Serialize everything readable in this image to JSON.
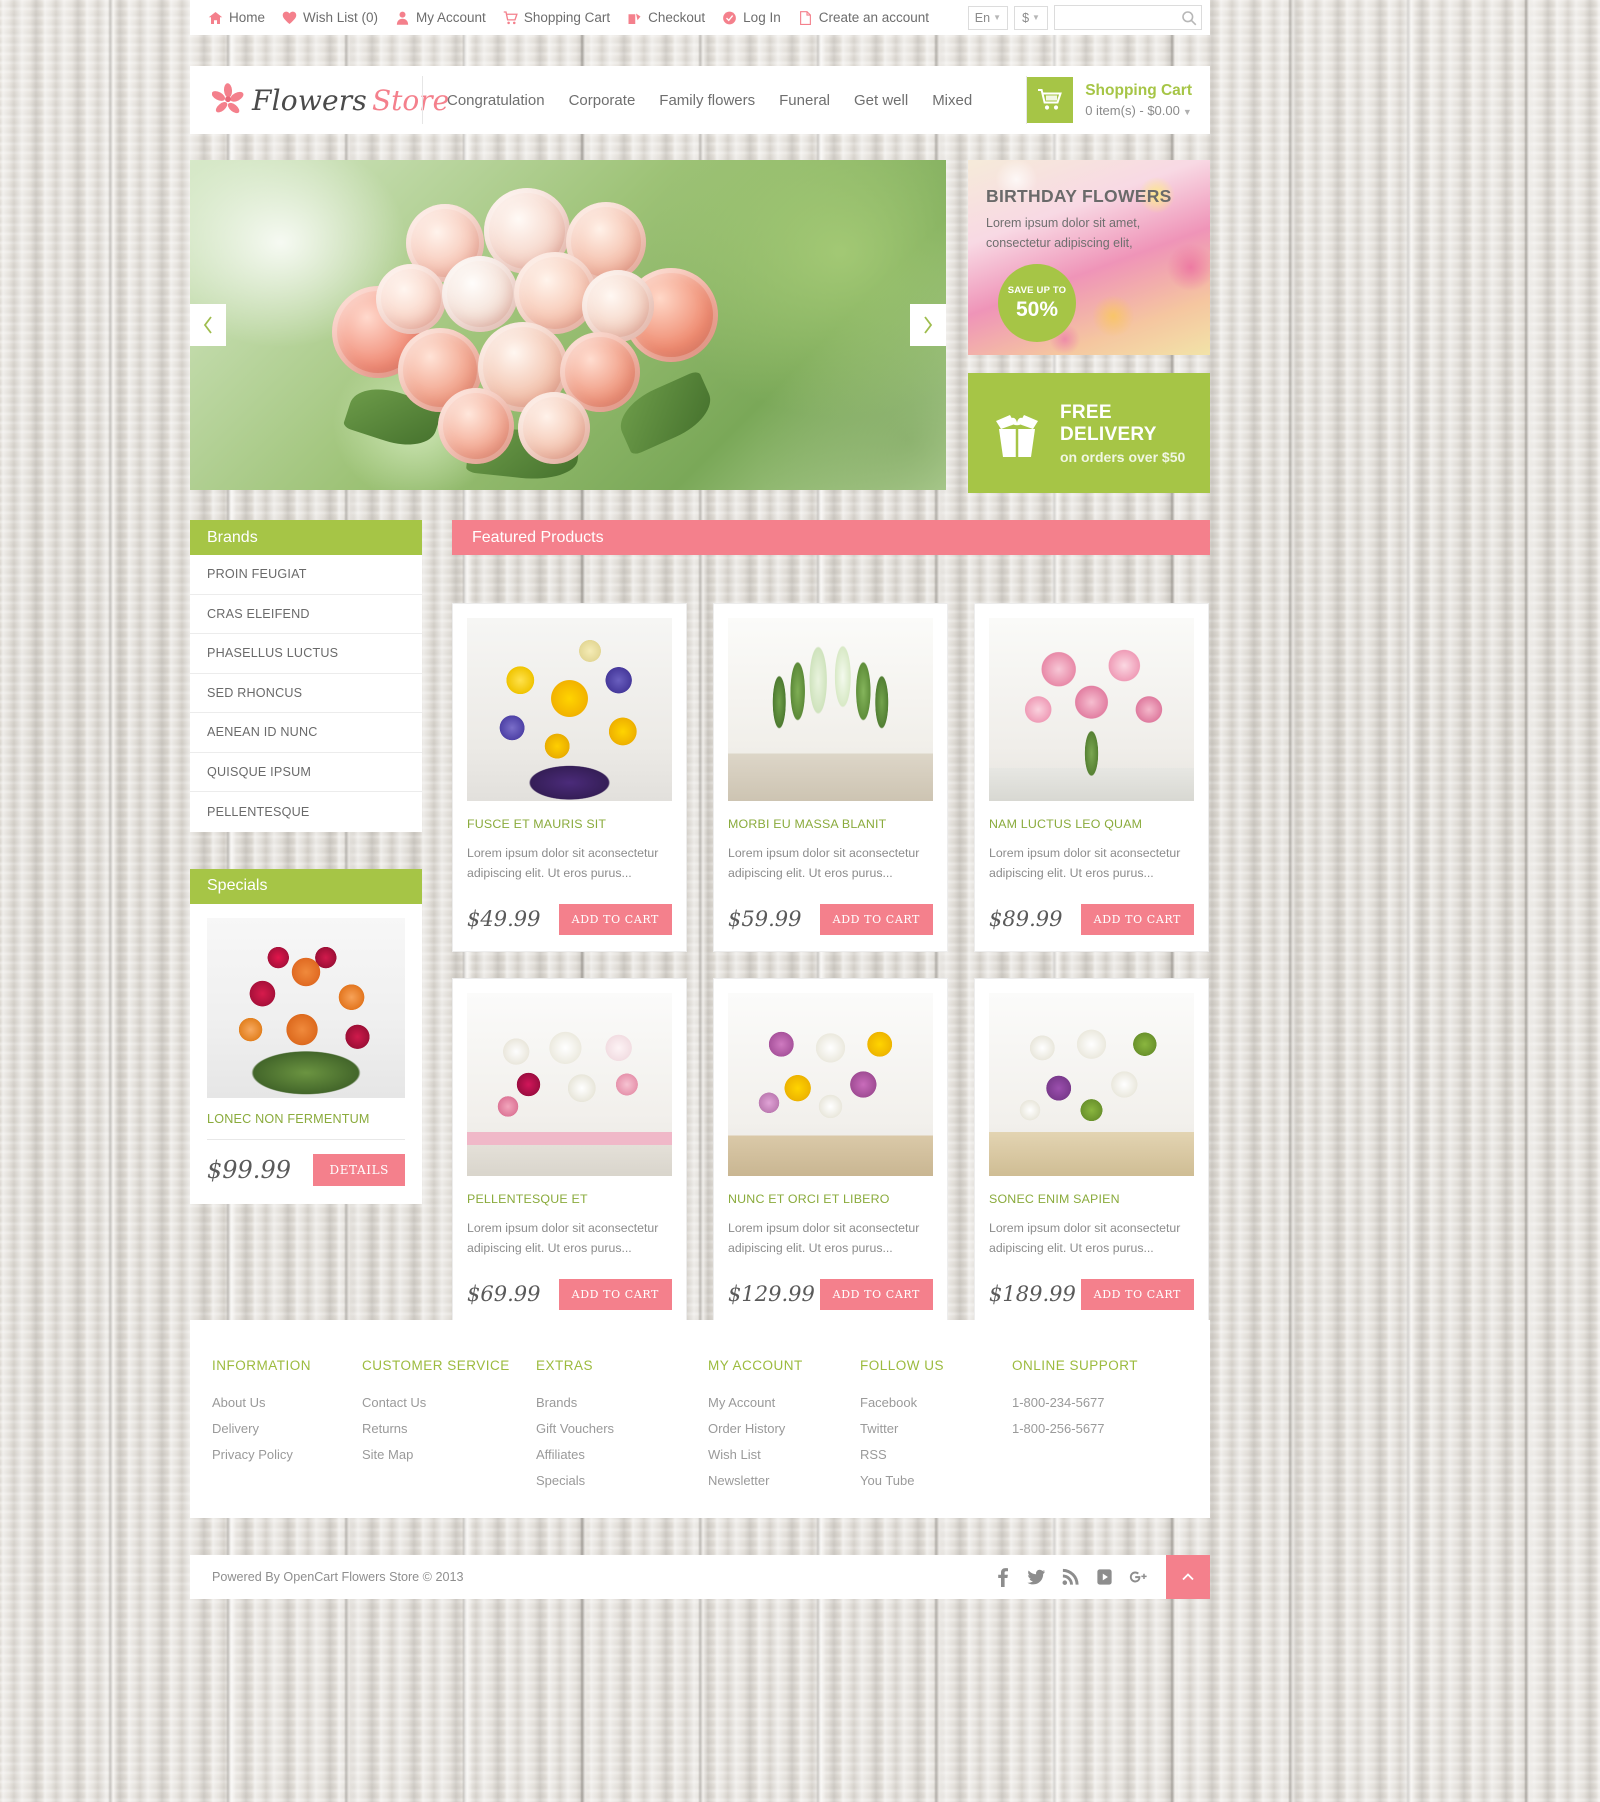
{
  "topbar": {
    "links": [
      {
        "label": "Home",
        "icon": "home-icon"
      },
      {
        "label": "Wish List (0)",
        "icon": "heart-icon"
      },
      {
        "label": "My Account",
        "icon": "user-icon"
      },
      {
        "label": "Shopping Cart",
        "icon": "cart-icon"
      },
      {
        "label": "Checkout",
        "icon": "checkout-icon"
      },
      {
        "label": "Log In",
        "icon": "login-icon"
      },
      {
        "label": "Create an account",
        "icon": "page-icon"
      }
    ],
    "language": "En",
    "currency": "$",
    "search_value": "",
    "search_placeholder": ""
  },
  "header": {
    "logo_word1": "Flowers",
    "logo_word2": "Store",
    "nav": [
      {
        "label": "Congratulation"
      },
      {
        "label": "Corporate"
      },
      {
        "label": "Family flowers"
      },
      {
        "label": "Funeral"
      },
      {
        "label": "Get well"
      },
      {
        "label": "Mixed"
      }
    ],
    "cart_title": "Shopping Cart",
    "cart_sub": "0 item(s) - $0.00",
    "cart_caret": "⌄"
  },
  "slider": {
    "prev": "‹",
    "next": "›"
  },
  "banners": {
    "birthday": {
      "title": "BIRTHDAY FLOWERS",
      "line1": "Lorem ipsum dolor sit amet,",
      "line2": "consectetur adipiscing elit,",
      "badge_top": "SAVE UP TO",
      "badge_value": "50%"
    },
    "delivery": {
      "title": "FREE DELIVERY",
      "subtitle": "on orders over $50"
    }
  },
  "sidebar": {
    "brands_heading": "Brands",
    "brands": [
      {
        "label": "PROIN FEUGIAT"
      },
      {
        "label": "CRAS ELEIFEND"
      },
      {
        "label": "PHASELLUS LUCTUS"
      },
      {
        "label": "SED RHONCUS"
      },
      {
        "label": "AENEAN ID NUNC"
      },
      {
        "label": "QUISQUE IPSUM"
      },
      {
        "label": "PELLENTESQUE"
      }
    ],
    "specials_heading": "Specials",
    "special": {
      "title": "LONEC NON FERMENTUM",
      "price": "$99.99",
      "button": "DETAILS"
    }
  },
  "featured": {
    "heading": "Featured Products",
    "products": [
      {
        "title": "FUSCE ET MAURIS SIT",
        "desc": "Lorem ipsum dolor sit aconsectetur adipiscing elit. Ut eros purus...",
        "price": "$49.99",
        "button": "ADD TO CART",
        "img": "yellow-purple-basket"
      },
      {
        "title": "MORBI EU MASSA BLANIT",
        "desc": "Lorem ipsum dolor sit aconsectetur adipiscing elit. Ut eros purus...",
        "price": "$59.99",
        "button": "ADD TO CART",
        "img": "white-calla-pot"
      },
      {
        "title": "NAM LUCTUS LEO QUAM",
        "desc": "Lorem ipsum dolor sit aconsectetur adipiscing elit. Ut eros purus...",
        "price": "$89.99",
        "button": "ADD TO CART",
        "img": "pink-lilies-vase"
      },
      {
        "title": "PELLENTESQUE ET",
        "desc": "Lorem ipsum dolor sit aconsectetur adipiscing elit. Ut eros purus...",
        "price": "$69.99",
        "button": "ADD TO CART",
        "img": "pink-white-daisies"
      },
      {
        "title": "NUNC ET ORCI ET LIBERO",
        "desc": "Lorem ipsum dolor sit aconsectetur adipiscing elit. Ut eros purus...",
        "price": "$129.99",
        "button": "ADD TO CART",
        "img": "yellow-purple-daisies"
      },
      {
        "title": "SONEC ENIM SAPIEN",
        "desc": "Lorem ipsum dolor sit aconsectetur adipiscing elit. Ut eros purus...",
        "price": "$189.99",
        "button": "ADD TO CART",
        "img": "green-white-basket"
      }
    ]
  },
  "footer": {
    "columns": [
      {
        "heading": "INFORMATION",
        "links": [
          {
            "label": "About Us"
          },
          {
            "label": "Delivery"
          },
          {
            "label": "Privacy Policy"
          }
        ]
      },
      {
        "heading": "CUSTOMER SERVICE",
        "links": [
          {
            "label": "Contact Us"
          },
          {
            "label": "Returns"
          },
          {
            "label": "Site Map"
          }
        ]
      },
      {
        "heading": "EXTRAS",
        "links": [
          {
            "label": "Brands"
          },
          {
            "label": "Gift Vouchers"
          },
          {
            "label": "Affiliates"
          },
          {
            "label": "Specials"
          }
        ]
      },
      {
        "heading": "MY ACCOUNT",
        "links": [
          {
            "label": "My Account"
          },
          {
            "label": "Order History"
          },
          {
            "label": "Wish List"
          },
          {
            "label": "Newsletter"
          }
        ]
      },
      {
        "heading": "FOLLOW US",
        "links": [
          {
            "label": "Facebook"
          },
          {
            "label": "Twitter"
          },
          {
            "label": "RSS"
          },
          {
            "label": "You Tube"
          }
        ]
      },
      {
        "heading": "ONLINE SUPPORT",
        "links": [
          {
            "label": "1-800-234-5677"
          },
          {
            "label": "1-800-256-5677"
          }
        ]
      }
    ],
    "copyright": "Powered By OpenCart Flowers Store © 2013",
    "socials": [
      {
        "name": "facebook-icon"
      },
      {
        "name": "twitter-icon"
      },
      {
        "name": "rss-icon"
      },
      {
        "name": "youtube-icon"
      },
      {
        "name": "google-plus-icon"
      }
    ]
  },
  "colors": {
    "pink": "#f4808c",
    "green": "#a6c546",
    "text_gray": "#6a6a6a"
  }
}
